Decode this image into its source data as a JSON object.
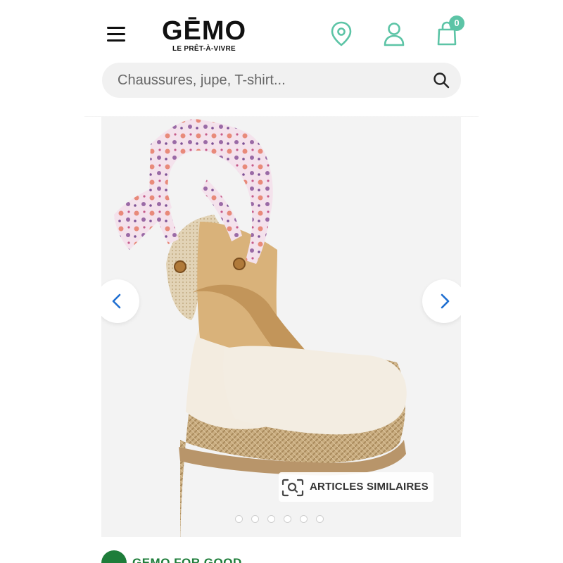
{
  "header": {
    "logo_text": "GĒMO",
    "logo_tagline": "LE PRÊT-À-VIVRE",
    "cart_count": "0",
    "menu_icon": "hamburger-menu-icon",
    "store_icon": "location-pin-icon",
    "account_icon": "user-icon",
    "cart_icon": "shopping-bag-icon"
  },
  "search": {
    "placeholder": "Chaussures, jupe, T-shirt...",
    "value": "",
    "icon": "search-icon"
  },
  "gallery": {
    "image_alt": "Espadrille compensée écrue à lacets fleuris",
    "similar_articles_label": "ARTICLES SIMILAIRES",
    "slide_count": 6,
    "active_slide": 1
  },
  "footer_teaser": {
    "label": "GEMO FOR GOOD"
  },
  "colors": {
    "accent": "#5cc4a6",
    "arrow": "#1f6fd1",
    "gemo_for_good": "#1e7d3a",
    "background": "#f3f3f3"
  }
}
